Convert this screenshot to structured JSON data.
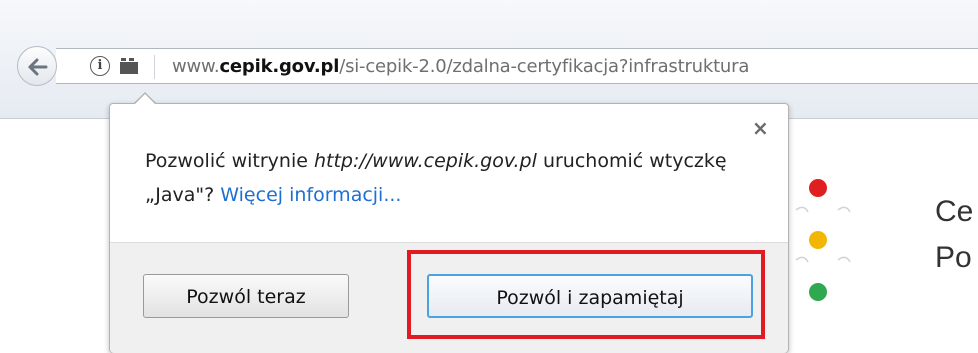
{
  "browser": {
    "url": {
      "prefix": "www.",
      "domain": "cepik.gov.pl",
      "path": "/si-cepik-2.0/zdalna-certyfikacja?infrastruktura"
    },
    "icons": {
      "back": "back-arrow-icon",
      "info": "info-icon",
      "plugin": "plugin-icon"
    }
  },
  "panel": {
    "message_before": "Pozwolić witrynie ",
    "message_url": "http://www.cepik.gov.pl",
    "message_after": " uruchomić wtyczkę „Java\"? ",
    "more_info_link": "Więcej informacji...",
    "close_symbol": "×",
    "buttons": {
      "allow_now": "Pozwól teraz",
      "allow_remember": "Pozwól i zapamiętaj"
    }
  },
  "background_page": {
    "heading_line1": "Ce",
    "heading_line2": "Po",
    "logo_colors": [
      "#e02020",
      "#f2b705",
      "#2fa84f"
    ]
  },
  "annotation": {
    "highlight_color": "#e01b24"
  }
}
